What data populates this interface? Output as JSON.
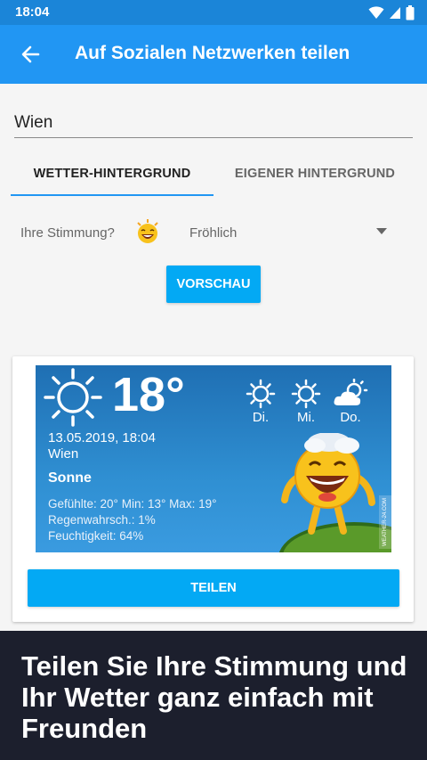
{
  "status_bar": {
    "time": "18:04"
  },
  "app_bar": {
    "title": "Auf Sozialen Netzwerken teilen"
  },
  "city_input": {
    "value": "Wien"
  },
  "tabs": [
    {
      "label": "WETTER-HINTERGRUND",
      "active": true
    },
    {
      "label": "EIGENER HINTERGRUND",
      "active": false
    }
  ],
  "mood": {
    "label": "Ihre Stimmung?",
    "selected": "Fröhlich"
  },
  "preview_button": {
    "label": "VORSCHAU"
  },
  "weather_card": {
    "temperature": "18°",
    "forecast_days": [
      "Di.",
      "Mi.",
      "Do."
    ],
    "datetime": "13.05.2019, 18:04",
    "city": "Wien",
    "condition": "Sonne",
    "feels_like": "Gefühlte: 20° Min: 13° Max: 19°",
    "precipitation": "Regenwahrsch.: 1%",
    "humidity": "Feuchtigkeit: 64%",
    "watermark": "WEATHER-24.COM"
  },
  "share_button": {
    "label": "TEILEN"
  },
  "promo_banner": {
    "text": "Teilen Sie Ihre Stimmung und Ihr Wetter ganz einfach mit Freunden"
  },
  "colors": {
    "status_bar": "#1b85d8",
    "app_bar": "#2196f3",
    "accent_button": "#03a9f4",
    "banner_bg": "#1c1f2d"
  }
}
